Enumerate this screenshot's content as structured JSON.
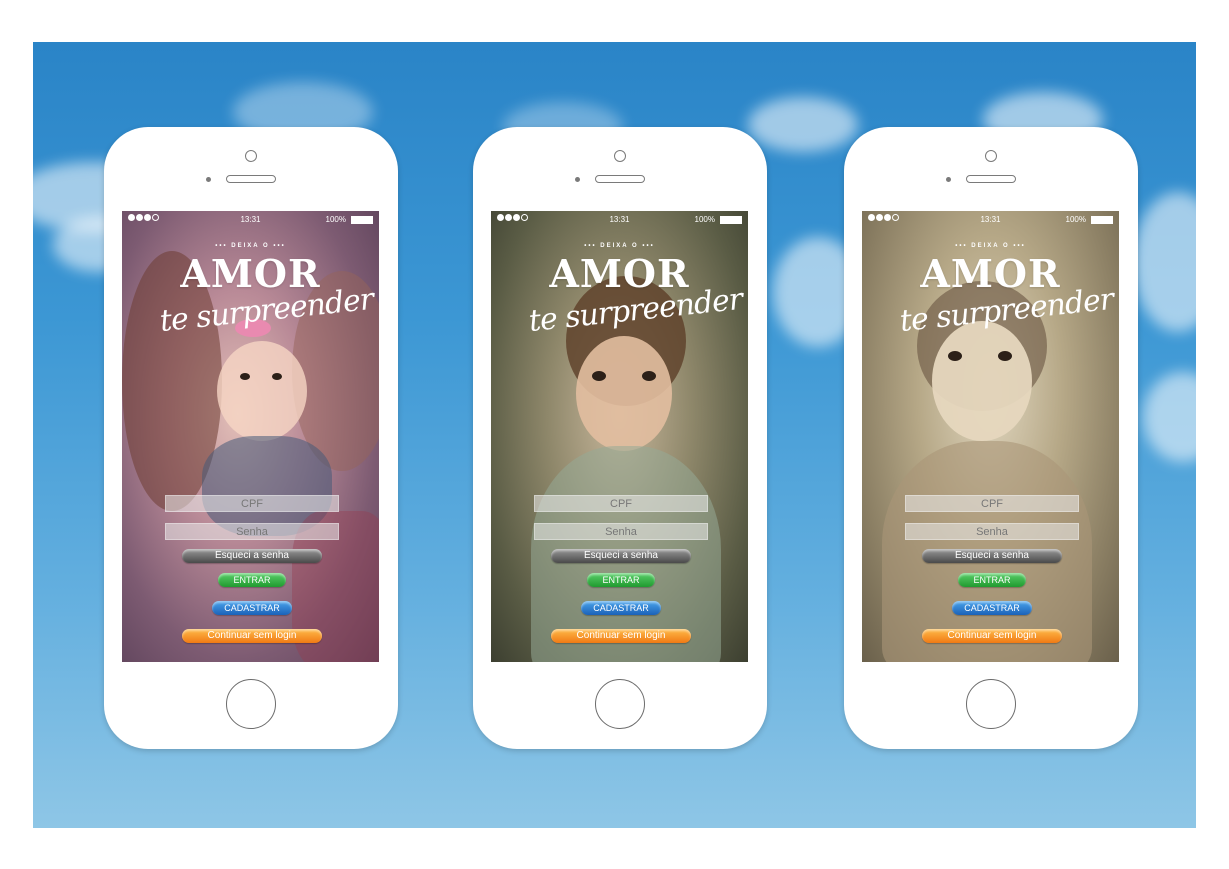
{
  "phones": [
    {
      "status": {
        "time": "13:31",
        "battery": "100%"
      },
      "logo": {
        "tagline": "••• DEIXA O •••",
        "title": "AMOR",
        "subtitle": "te surpreender"
      },
      "form": {
        "cpf_placeholder": "CPF",
        "password_placeholder": "Senha",
        "forgot_label": "Esqueci a senha",
        "enter_label": "ENTRAR",
        "signup_label": "CADASTRAR",
        "continue_label": "Continuar sem login"
      }
    },
    {
      "status": {
        "time": "13:31",
        "battery": "100%"
      },
      "logo": {
        "tagline": "••• DEIXA O •••",
        "title": "AMOR",
        "subtitle": "te surpreender"
      },
      "form": {
        "cpf_placeholder": "CPF",
        "password_placeholder": "Senha",
        "forgot_label": "Esqueci a senha",
        "enter_label": "ENTRAR",
        "signup_label": "CADASTRAR",
        "continue_label": "Continuar sem login"
      }
    },
    {
      "status": {
        "time": "13:31",
        "battery": "100%"
      },
      "logo": {
        "tagline": "••• DEIXA O •••",
        "title": "AMOR",
        "subtitle": "te surpreender"
      },
      "form": {
        "cpf_placeholder": "CPF",
        "password_placeholder": "Senha",
        "forgot_label": "Esqueci a senha",
        "enter_label": "ENTRAR",
        "signup_label": "CADASTRAR",
        "continue_label": "Continuar sem login"
      }
    }
  ],
  "colors": {
    "sky": "#3c97d4",
    "enter_button": "#2fb844",
    "signup_button": "#2a7fd0",
    "continue_button": "#f58a1f",
    "forgot_button": "#6a6a6a"
  }
}
